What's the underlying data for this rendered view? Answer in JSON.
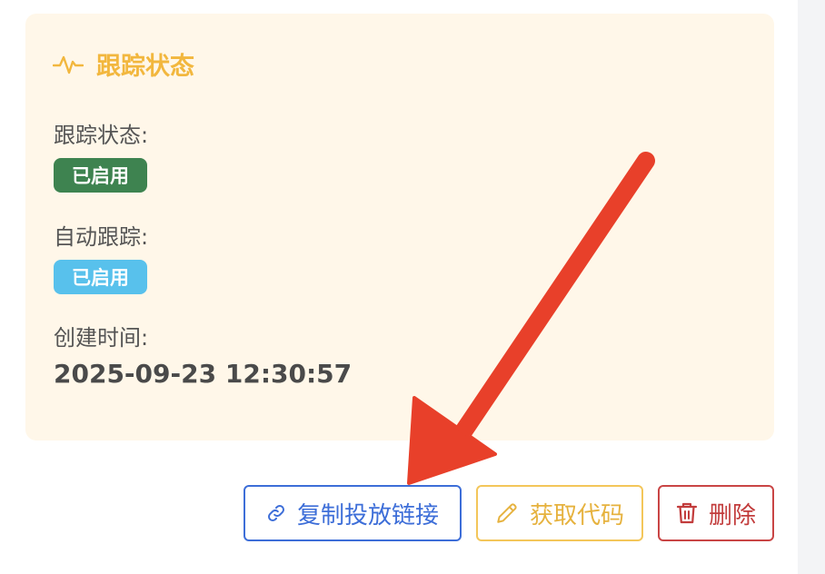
{
  "card": {
    "title": "跟踪状态",
    "title_icon": "pulse-icon",
    "fields": {
      "tracking_status": {
        "label": "跟踪状态:",
        "badge": "已启用",
        "badge_color": "#3e8350"
      },
      "auto_tracking": {
        "label": "自动跟踪:",
        "badge": "已启用",
        "badge_color": "#58c1ec"
      },
      "created_time": {
        "label": "创建时间:",
        "value": "2025-09-23 12:30:57"
      }
    }
  },
  "actions": {
    "copy_link": {
      "label": "复制投放链接",
      "icon": "link-icon",
      "color": "#3d6ed8"
    },
    "get_code": {
      "label": "获取代码",
      "icon": "pencil-icon",
      "color": "#e6b23e"
    },
    "delete": {
      "label": "删除",
      "icon": "trash-icon",
      "color": "#c23c3c"
    }
  },
  "annotation": {
    "arrow_color": "#e8402a"
  }
}
